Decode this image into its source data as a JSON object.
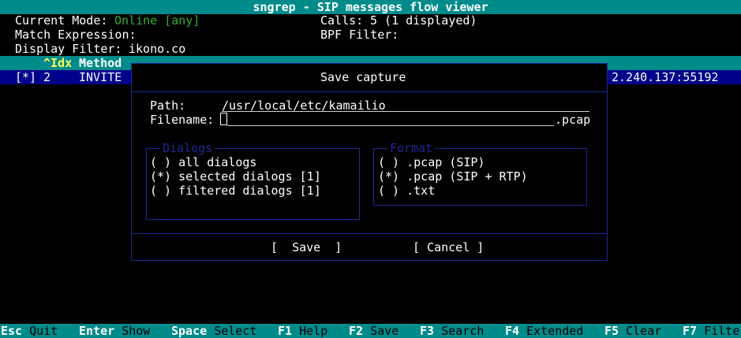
{
  "title": "sngrep - SIP messages flow viewer",
  "header": {
    "mode_label": "Current Mode:",
    "mode_value": "Online [any]",
    "match_label": "Match Expression:",
    "filter_label": "Display Filter:",
    "filter_value": "ikono.co",
    "calls_label": "Calls:",
    "calls_value": "5 (1 displayed)",
    "bpf_label": "BPF Filter:"
  },
  "list": {
    "col_idx": "^Idx",
    "col_method": "Method",
    "row": {
      "selected": "[*]",
      "idx": "2",
      "method": "INVITE",
      "dst": "2.240.137:55192"
    }
  },
  "dialog": {
    "title": "Save capture",
    "path_label": "Path:",
    "path_value": "/usr/local/etc/kamailio",
    "filename_label": "Filename:",
    "filename_ext": ".pcap",
    "dialogs_legend": "Dialogs",
    "dialog_options": [
      "( ) all dialogs",
      "(*) selected dialogs [1]",
      "( ) filtered dialogs [1]"
    ],
    "format_legend": "Format",
    "format_options": [
      "( ) .pcap (SIP)",
      "(*) .pcap (SIP + RTP)",
      "( ) .txt"
    ],
    "save_button": "[  Save  ]",
    "cancel_button": "[ Cancel ]"
  },
  "footer": [
    {
      "key": "Esc",
      "label": "Quit"
    },
    {
      "key": "Enter",
      "label": "Show"
    },
    {
      "key": "Space",
      "label": "Select"
    },
    {
      "key": "F1",
      "label": "Help"
    },
    {
      "key": "F2",
      "label": "Save"
    },
    {
      "key": "F3",
      "label": "Search"
    },
    {
      "key": "F4",
      "label": "Extended"
    },
    {
      "key": "F5",
      "label": "Clear"
    },
    {
      "key": "F7",
      "label": "Filte"
    }
  ],
  "colors": {
    "accent_cyan": "#008b8b",
    "selected_row": "#00008b",
    "online_green": "#30b030",
    "border_blue": "#1a2a99",
    "idx_yellow": "#ffff55"
  }
}
